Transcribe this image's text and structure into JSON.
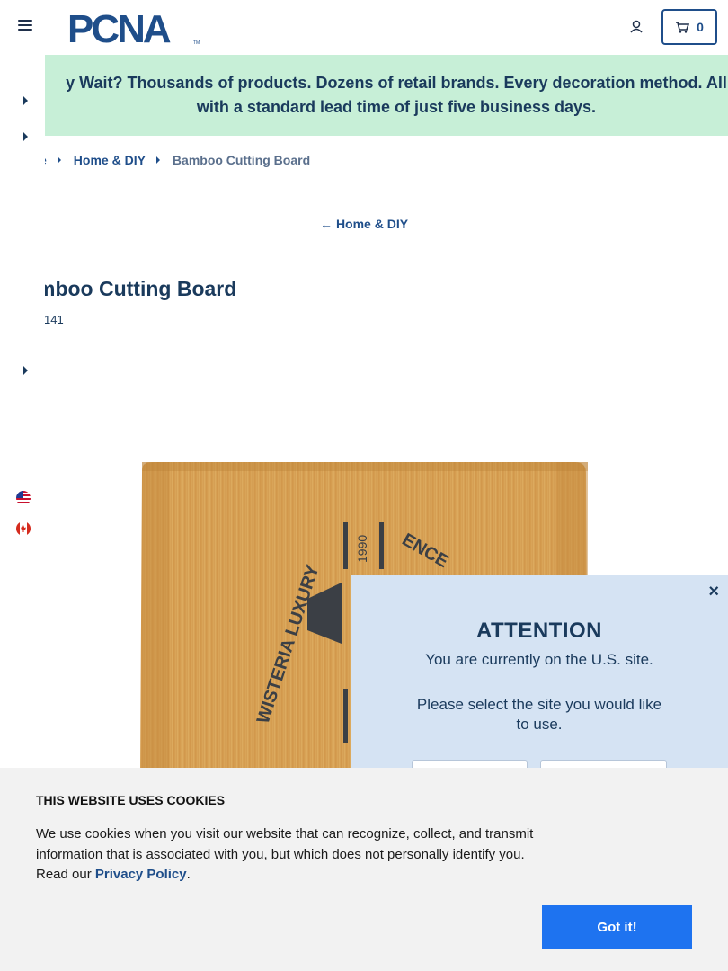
{
  "header": {
    "logo_text": "PCNA",
    "logo_tm": "TM",
    "cart_count": "0"
  },
  "promo": {
    "line1": "y Wait? Thousands of products. Dozens of retail brands. Every decoration method. All",
    "line2": "with a standard lead time of just five business days."
  },
  "breadcrumb": {
    "items": [
      "e",
      "Home & DIY"
    ],
    "current": "Bamboo Cutting Board"
  },
  "back_link": {
    "arrow": "←",
    "label": "Home & DIY"
  },
  "product": {
    "title": "mboo Cutting Board",
    "sku": "141",
    "image": {
      "logo_ring_text": "WISTERIA LUXURY",
      "logo_ring_text_right": "ENCE",
      "logo_year": "1990"
    }
  },
  "attention": {
    "close": "×",
    "title": "ATTENTION",
    "line1": "You are currently on the U.S. site.",
    "line2": "Please select the site you would like to use."
  },
  "cookie": {
    "title": "THIS WEBSITE USES COOKIES",
    "body": "We use cookies when you visit our website that can recognize, collect, and transmit information that is associated with you, but which does not personally identify you. Read our ",
    "link": "Privacy Policy",
    "period": ".",
    "button": "Got it!"
  },
  "colors": {
    "promo_bg": "#c7efd7",
    "navy": "#1a3a5c",
    "link_blue": "#1f4e8a",
    "attention_bg": "#d5e3f3",
    "cookie_bg": "#f2f2f2",
    "cookie_button": "#1e73f0",
    "bamboo": "#d9a55a"
  }
}
